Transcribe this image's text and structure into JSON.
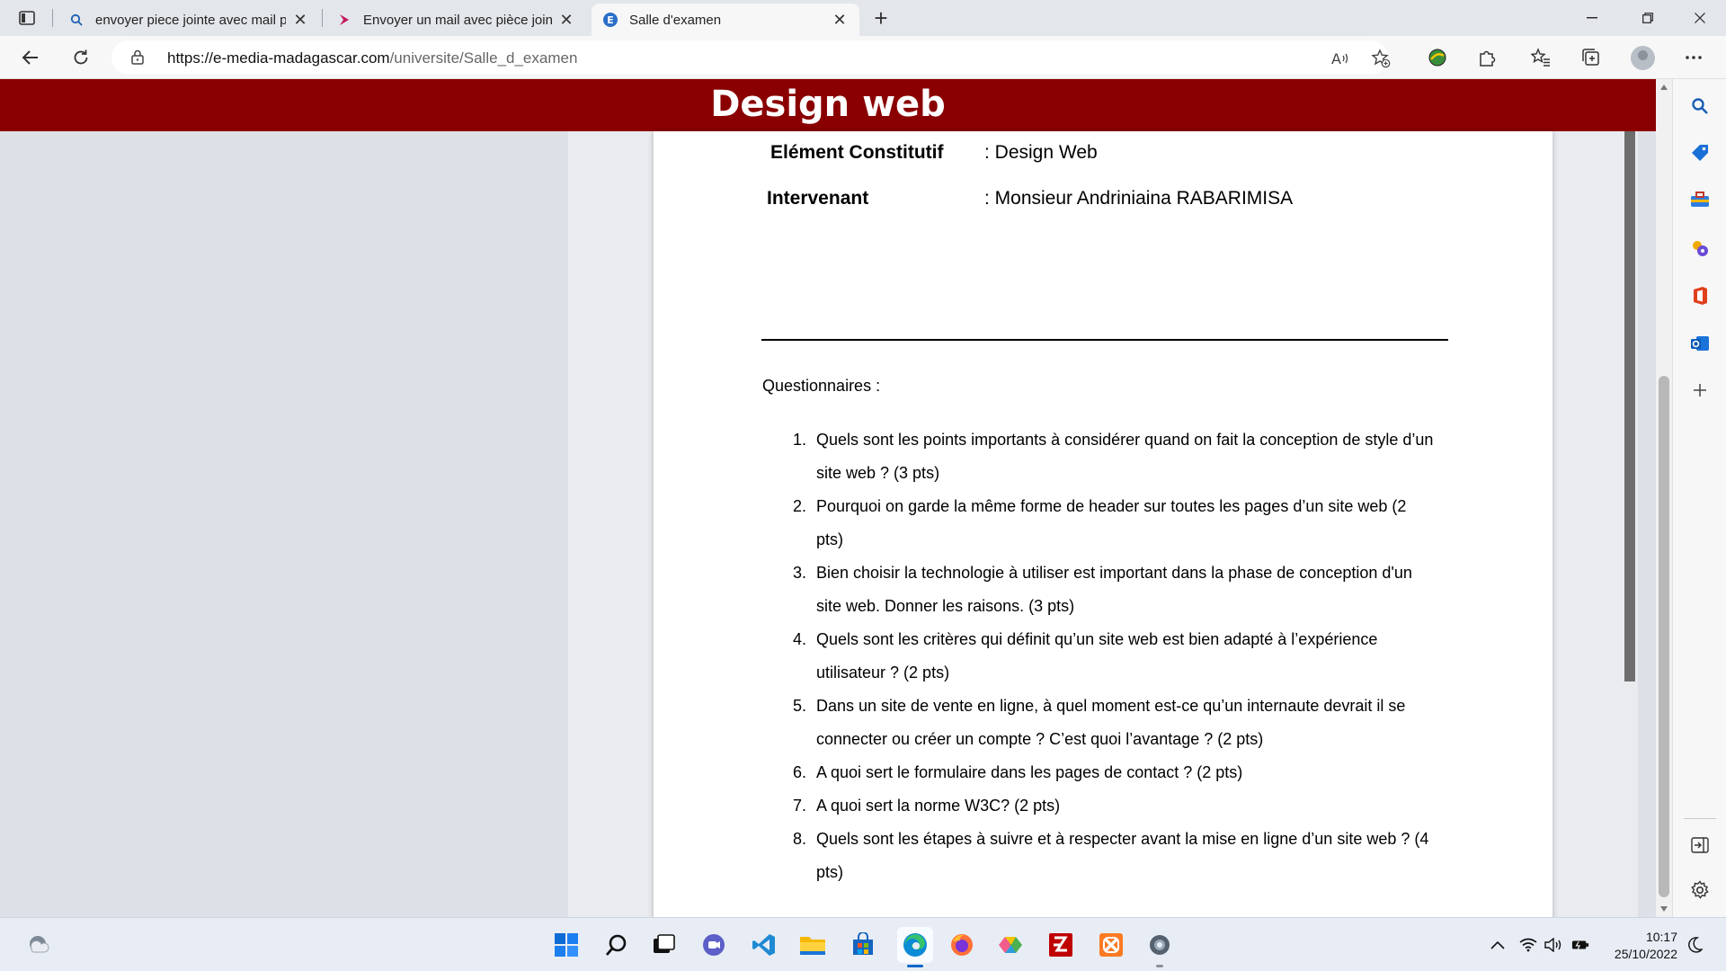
{
  "browser": {
    "tabs": [
      {
        "title": "envoyer piece jointe avec mail ph",
        "icon": "search-icon",
        "active": false
      },
      {
        "title": "Envoyer un mail avec pièce jointe",
        "icon": "site-favicon-icon",
        "active": false
      },
      {
        "title": "Salle d'examen",
        "icon": "site-favicon-icon",
        "active": true
      }
    ],
    "url_host": "https://e-media-madagascar.com",
    "url_path": "/universite/Salle_d_examen"
  },
  "page": {
    "banner_title": "Design web",
    "meta": [
      {
        "label": "Elément Constitutif",
        "value": ": Design Web"
      },
      {
        "label": "Intervenant",
        "value": ": Monsieur Andriniaina RABARIMISA"
      }
    ],
    "questions_heading": "Questionnaires :",
    "questions": [
      {
        "num": "1.",
        "text": "Quels sont les points importants à considérer quand on fait la conception de style d’un site web ? (3 pts)"
      },
      {
        "num": "2.",
        "text": "Pourquoi on garde la même forme de header sur toutes les pages d’un site web (2 pts)"
      },
      {
        "num": "3.",
        "text": "Bien choisir la technologie à utiliser est important dans la phase de conception d'un site web. Donner les raisons. (3 pts)"
      },
      {
        "num": "4.",
        "text": "Quels sont les critères qui définit qu’un site web est bien adapté à l’expérience utilisateur ? (2 pts)"
      },
      {
        "num": "5.",
        "text": "Dans un site de vente en ligne, à quel moment est-ce qu’un internaute devrait il se connecter ou créer un compte ? C’est quoi l’avantage ? (2 pts)"
      },
      {
        "num": "6.",
        "text": "A quoi sert le formulaire dans les pages de contact ? (2 pts)"
      },
      {
        "num": "7.",
        "text": "A quoi sert la norme W3C? (2 pts)"
      },
      {
        "num": "8.",
        "text": "Quels sont les étapes à suivre et à respecter avant la mise en ligne d’un site web ? (4 pts)"
      }
    ]
  },
  "taskbar": {
    "time": "10:17",
    "date": "25/10/2022"
  },
  "colors": {
    "banner": "#8a0000",
    "accent": "#0a66c8"
  }
}
